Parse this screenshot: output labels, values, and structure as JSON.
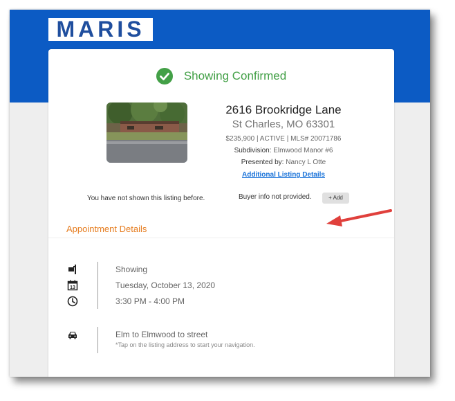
{
  "header": {
    "logo_text": "MARIS",
    "band_color": "#0c5bc4"
  },
  "confirmation": {
    "text": "Showing Confirmed",
    "icon": "check-circle-icon",
    "color": "#43a047"
  },
  "listing": {
    "address": "2616 Brookridge Lane",
    "city": "St Charles, MO 63301",
    "meta": "$235,900 | ACTIVE | MLS# 20071786",
    "subdivision_label": "Subdivision:",
    "subdivision_value": "Elmwood Manor #6",
    "presented_label": "Presented by:",
    "presented_value": "Nancy L Otte",
    "details_link": "Additional Listing Details"
  },
  "status": {
    "not_shown": "You have not shown this listing before.",
    "buyer_info": "Buyer info not provided.",
    "add_label": "+ Add"
  },
  "appointment": {
    "section_title": "Appointment Details",
    "section_color": "#e67e22",
    "type": "Showing",
    "date": "Tuesday, October 13, 2020",
    "time": "3:30 PM - 4:00 PM",
    "calendar_day": "13",
    "directions": "Elm to Elmwood to street",
    "nav_hint": "*Tap on the listing address to start your navigation."
  },
  "annotation": {
    "arrow_color": "#e0403c"
  }
}
